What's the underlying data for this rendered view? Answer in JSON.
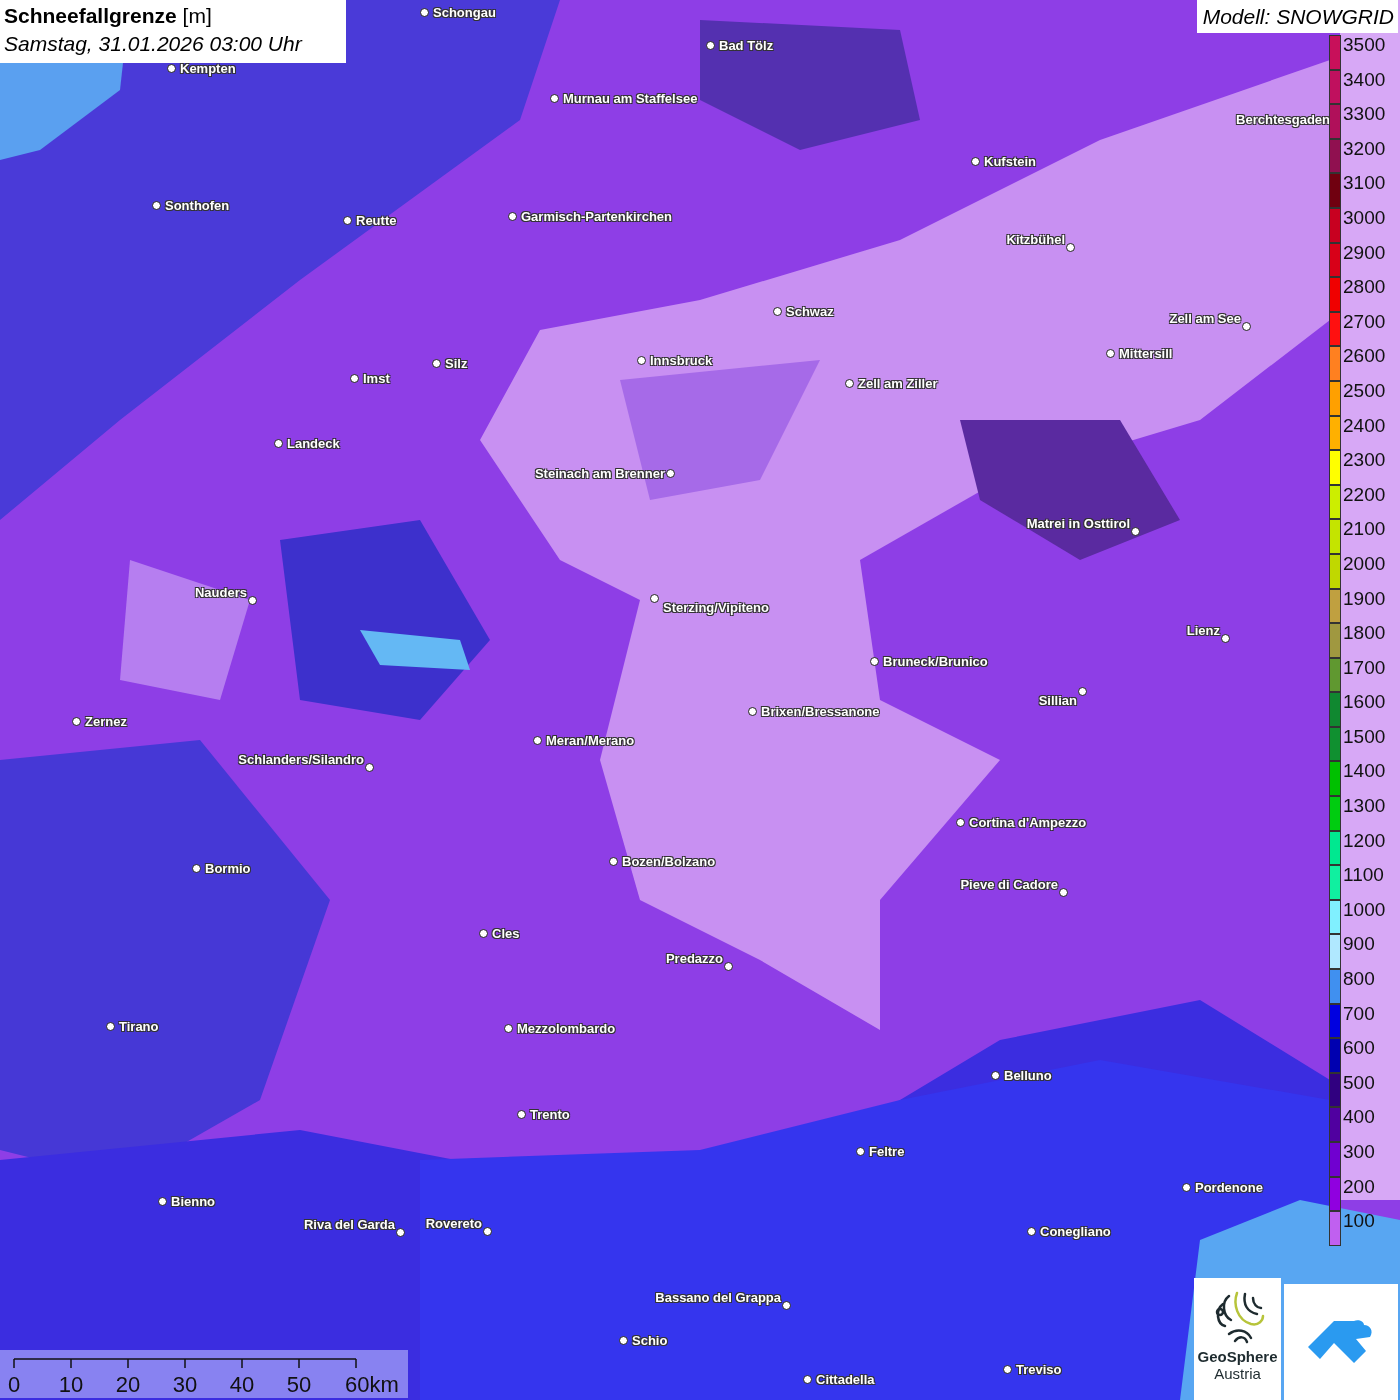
{
  "title": {
    "parameter": "Schneefallgrenze",
    "unit": "[m]",
    "time": "Samstag, 31.01.2026 03:00 Uhr"
  },
  "model": "Modell: SNOWGRID",
  "legend": [
    {
      "label": "3500",
      "color": "#c8105a"
    },
    {
      "label": "3400",
      "color": "#c0105e"
    },
    {
      "label": "3300",
      "color": "#b0105a"
    },
    {
      "label": "3200",
      "color": "#901050"
    },
    {
      "label": "3100",
      "color": "#700010"
    },
    {
      "label": "3000",
      "color": "#c80020"
    },
    {
      "label": "2900",
      "color": "#d80018"
    },
    {
      "label": "2800",
      "color": "#f00000"
    },
    {
      "label": "2700",
      "color": "#ff1010"
    },
    {
      "label": "2600",
      "color": "#ff8020"
    },
    {
      "label": "2500",
      "color": "#ffa000"
    },
    {
      "label": "2400",
      "color": "#ffb000"
    },
    {
      "label": "2300",
      "color": "#ffff00"
    },
    {
      "label": "2200",
      "color": "#ccee00"
    },
    {
      "label": "2100",
      "color": "#c4e400"
    },
    {
      "label": "2000",
      "color": "#c0d800"
    },
    {
      "label": "1900",
      "color": "#c0a040"
    },
    {
      "label": "1800",
      "color": "#a09840"
    },
    {
      "label": "1700",
      "color": "#609830"
    },
    {
      "label": "1600",
      "color": "#108830"
    },
    {
      "label": "1500",
      "color": "#109030"
    },
    {
      "label": "1400",
      "color": "#00c000"
    },
    {
      "label": "1300",
      "color": "#00cc10"
    },
    {
      "label": "1200",
      "color": "#00e890"
    },
    {
      "label": "1100",
      "color": "#10f0a0"
    },
    {
      "label": "1000",
      "color": "#80f0ff"
    },
    {
      "label": "900",
      "color": "#b0e8ff"
    },
    {
      "label": "800",
      "color": "#4090f0"
    },
    {
      "label": "700",
      "color": "#0000e0"
    },
    {
      "label": "600",
      "color": "#0000b0"
    },
    {
      "label": "500",
      "color": "#300080"
    },
    {
      "label": "400",
      "color": "#5000a0"
    },
    {
      "label": "300",
      "color": "#7000d0"
    },
    {
      "label": "200",
      "color": "#9000e0"
    },
    {
      "label": "100",
      "color": "#c060f0"
    }
  ],
  "cities": [
    {
      "name": "Schongau"
    },
    {
      "name": "Kempten"
    },
    {
      "name": "Bad Tölz"
    },
    {
      "name": "Murnau am Staffelsee"
    },
    {
      "name": "Berchtesgaden"
    },
    {
      "name": "Kufstein"
    },
    {
      "name": "Sonthofen"
    },
    {
      "name": "Reutte"
    },
    {
      "name": "Garmisch-Partenkirchen"
    },
    {
      "name": "Kitzbühel"
    },
    {
      "name": "Schwaz"
    },
    {
      "name": "Zell am See"
    },
    {
      "name": "Mittersill"
    },
    {
      "name": "Innsbruck"
    },
    {
      "name": "Imst"
    },
    {
      "name": "Silz"
    },
    {
      "name": "Zell am Ziller"
    },
    {
      "name": "Landeck"
    },
    {
      "name": "Steinach am Brenner"
    },
    {
      "name": "Matrei in Osttirol"
    },
    {
      "name": "Nauders"
    },
    {
      "name": "Sterzing/Vipiteno"
    },
    {
      "name": "Lienz"
    },
    {
      "name": "Bruneck/Brunico"
    },
    {
      "name": "Sillian"
    },
    {
      "name": "Brixen/Bressanone"
    },
    {
      "name": "Zernez"
    },
    {
      "name": "Meran/Merano"
    },
    {
      "name": "Schlanders/Silandro"
    },
    {
      "name": "Cortina d'Ampezzo"
    },
    {
      "name": "Bozen/Bolzano"
    },
    {
      "name": "Bormio"
    },
    {
      "name": "Pieve di Cadore"
    },
    {
      "name": "Cles"
    },
    {
      "name": "Predazzo"
    },
    {
      "name": "Tirano"
    },
    {
      "name": "Mezzolombardo"
    },
    {
      "name": "Belluno"
    },
    {
      "name": "Trento"
    },
    {
      "name": "Feltre"
    },
    {
      "name": "Pordenone"
    },
    {
      "name": "Bienno"
    },
    {
      "name": "Riva del Garda"
    },
    {
      "name": "Rovereto"
    },
    {
      "name": "Conegliano"
    },
    {
      "name": "Bassano del Grappa"
    },
    {
      "name": "Schio"
    },
    {
      "name": "Treviso"
    },
    {
      "name": "Cittadella"
    }
  ],
  "scale": {
    "ticks": [
      "0",
      "10",
      "20",
      "30",
      "40",
      "50",
      "60km"
    ]
  },
  "logo": {
    "name": "GeoSphere",
    "subtitle": "Austria"
  }
}
